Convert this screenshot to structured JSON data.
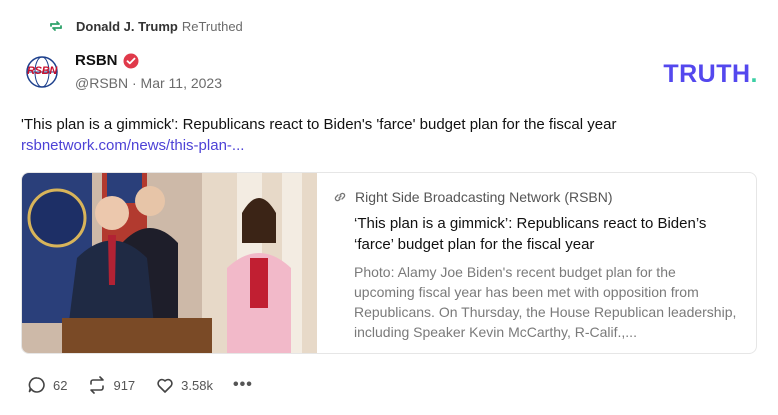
{
  "retruth": {
    "user": "Donald J. Trump",
    "label": "ReTruthed"
  },
  "author": {
    "avatar_text": "RSBN",
    "display_name": "RSBN",
    "handle_date": "@RSBN · Mar 11, 2023"
  },
  "brand": {
    "logo_text": "TRUTH",
    "logo_dot": ".",
    "accent": "#5448ee",
    "dot_color": "#3ccfa4"
  },
  "post": {
    "text": "'This plan is a gimmick': Republicans react to Biden's 'farce' budget plan for the fiscal year",
    "link": "rsbnetwork.com/news/this-plan-..."
  },
  "card": {
    "source": "Right Side Broadcasting Network (RSBN)",
    "title": "‘This plan is a gimmick’: Republicans react to Biden’s ‘farce’ budget plan for the fiscal year",
    "description": "Photo: Alamy Joe Biden's recent budget plan for the upcoming fiscal year has been met with opposition from Republicans. On Thursday, the House Republican leadership, including Speaker Kevin McCarthy, R-Calif.,..."
  },
  "actions": {
    "replies": "62",
    "retruths": "917",
    "likes": "3.58k",
    "more": "•••"
  },
  "icons": [
    "retruth-icon",
    "verified-icon",
    "link-icon",
    "reply-icon",
    "like-icon",
    "more-icon"
  ]
}
